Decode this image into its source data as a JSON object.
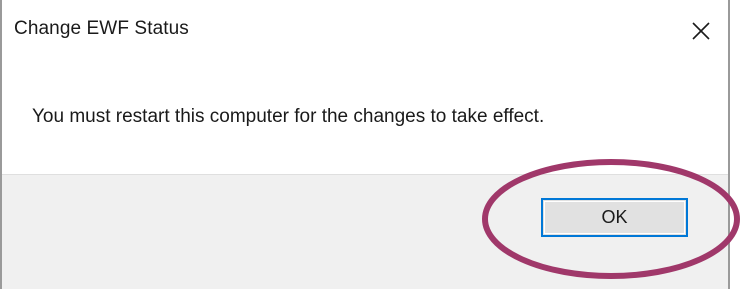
{
  "dialog": {
    "title": "Change EWF Status",
    "message": "You must restart this computer for the changes to take effect.",
    "ok_label": "OK",
    "close_icon": "close-icon"
  },
  "annotation": {
    "highlight_color": "#a0386a",
    "target": "ok-button"
  },
  "colors": {
    "button_border": "#0078d7",
    "footer_background": "#f0f0f0"
  }
}
